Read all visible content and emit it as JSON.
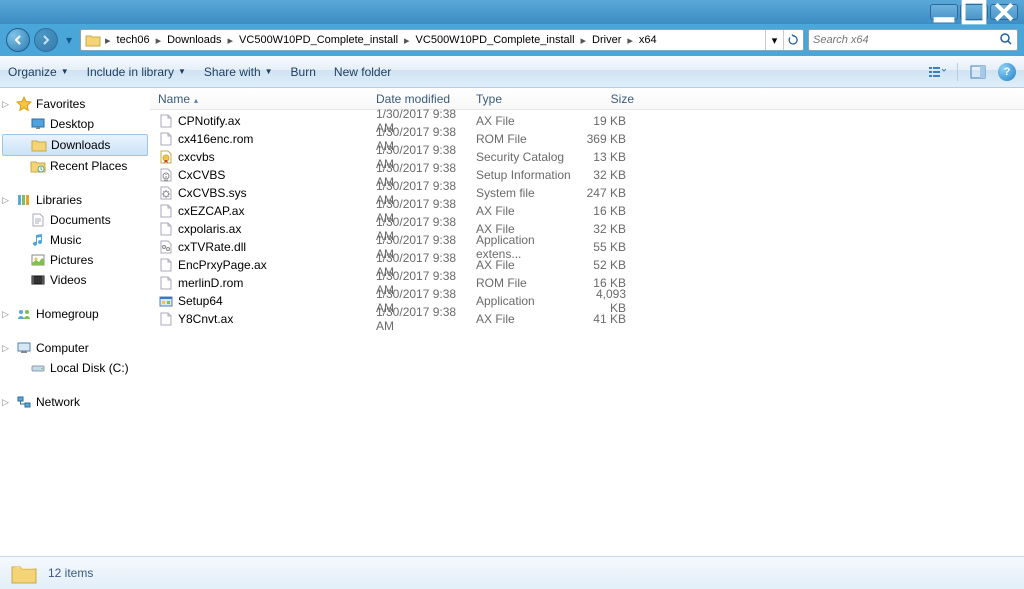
{
  "window": {
    "breadcrumb": [
      "tech06",
      "Downloads",
      "VC500W10PD_Complete_install",
      "VC500W10PD_Complete_install",
      "Driver",
      "x64"
    ],
    "search_placeholder": "Search x64"
  },
  "toolbar": {
    "organize": "Organize",
    "include": "Include in library",
    "share": "Share with",
    "burn": "Burn",
    "new_folder": "New folder"
  },
  "nav": {
    "favorites": {
      "label": "Favorites",
      "items": [
        "Desktop",
        "Downloads",
        "Recent Places"
      ],
      "selected": 1
    },
    "libraries": {
      "label": "Libraries",
      "items": [
        "Documents",
        "Music",
        "Pictures",
        "Videos"
      ]
    },
    "homegroup": {
      "label": "Homegroup"
    },
    "computer": {
      "label": "Computer",
      "items": [
        "Local Disk (C:)"
      ]
    },
    "network": {
      "label": "Network"
    }
  },
  "columns": {
    "name": "Name",
    "date": "Date modified",
    "type": "Type",
    "size": "Size"
  },
  "files": [
    {
      "name": "CPNotify.ax",
      "date": "1/30/2017 9:38 AM",
      "type": "AX File",
      "size": "19 KB",
      "icon": "file"
    },
    {
      "name": "cx416enc.rom",
      "date": "1/30/2017 9:38 AM",
      "type": "ROM File",
      "size": "369 KB",
      "icon": "file"
    },
    {
      "name": "cxcvbs",
      "date": "1/30/2017 9:38 AM",
      "type": "Security Catalog",
      "size": "13 KB",
      "icon": "cert"
    },
    {
      "name": "CxCVBS",
      "date": "1/30/2017 9:38 AM",
      "type": "Setup Information",
      "size": "32 KB",
      "icon": "inf"
    },
    {
      "name": "CxCVBS.sys",
      "date": "1/30/2017 9:38 AM",
      "type": "System file",
      "size": "247 KB",
      "icon": "sys"
    },
    {
      "name": "cxEZCAP.ax",
      "date": "1/30/2017 9:38 AM",
      "type": "AX File",
      "size": "16 KB",
      "icon": "file"
    },
    {
      "name": "cxpolaris.ax",
      "date": "1/30/2017 9:38 AM",
      "type": "AX File",
      "size": "32 KB",
      "icon": "file"
    },
    {
      "name": "cxTVRate.dll",
      "date": "1/30/2017 9:38 AM",
      "type": "Application extens...",
      "size": "55 KB",
      "icon": "dll"
    },
    {
      "name": "EncPrxyPage.ax",
      "date": "1/30/2017 9:38 AM",
      "type": "AX File",
      "size": "52 KB",
      "icon": "file"
    },
    {
      "name": "merlinD.rom",
      "date": "1/30/2017 9:38 AM",
      "type": "ROM File",
      "size": "16 KB",
      "icon": "file"
    },
    {
      "name": "Setup64",
      "date": "1/30/2017 9:38 AM",
      "type": "Application",
      "size": "4,093 KB",
      "icon": "exe"
    },
    {
      "name": "Y8Cnvt.ax",
      "date": "1/30/2017 9:38 AM",
      "type": "AX File",
      "size": "41 KB",
      "icon": "file"
    }
  ],
  "status": {
    "count": "12 items"
  }
}
